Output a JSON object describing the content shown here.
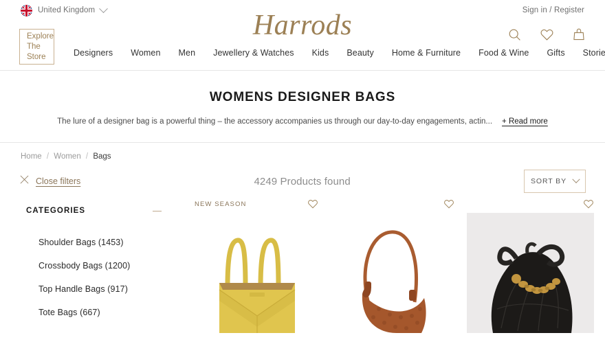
{
  "utility": {
    "locale_label": "United Kingdom",
    "locale_flag_icon": "uk-flag-icon",
    "locale_chevron_icon": "chevron-down-icon",
    "account_label": "Sign in / Register"
  },
  "brand": {
    "logo_text": "Harrods",
    "logo_color": "#9c8055"
  },
  "header_icons": [
    {
      "name": "search-icon",
      "label": "Search"
    },
    {
      "name": "heart-icon",
      "label": "Wishlist"
    },
    {
      "name": "shopping-bag-icon",
      "label": "Bag"
    }
  ],
  "nav": {
    "explore_line1": "Explore",
    "explore_line2": "The Store",
    "links": [
      {
        "label": "Designers"
      },
      {
        "label": "Women"
      },
      {
        "label": "Men"
      },
      {
        "label": "Jewellery & Watches"
      },
      {
        "label": "Kids"
      },
      {
        "label": "Beauty"
      },
      {
        "label": "Home & Furniture"
      },
      {
        "label": "Food & Wine"
      },
      {
        "label": "Gifts"
      },
      {
        "label": "Stories"
      }
    ]
  },
  "hero": {
    "title": "WOMENS DESIGNER BAGS",
    "description": "The lure of a designer bag is a powerful thing – the accessory accompanies us through our day-to-day engagements, actin...",
    "read_more_label": "+ Read more"
  },
  "breadcrumb": [
    {
      "label": "Home",
      "current": false
    },
    {
      "label": "Women",
      "current": false
    },
    {
      "label": "Bags",
      "current": true
    }
  ],
  "toolbar": {
    "close_filters_label": "Close filters",
    "close_filters_icon": "close-x-icon",
    "products_found": "4249 Products found",
    "sort_by_label": "SORT BY",
    "sort_chevron_icon": "chevron-down-icon"
  },
  "sidebar": {
    "facet_title": "CATEGORIES",
    "collapse_icon": "minus-icon",
    "items": [
      {
        "label": "Shoulder Bags (1453)"
      },
      {
        "label": "Crossbody Bags (1200)"
      },
      {
        "label": "Top Handle Bags (917)"
      },
      {
        "label": "Tote Bags (667)"
      }
    ]
  },
  "products": [
    {
      "badge": "NEW SEASON",
      "wishlist_icon": "heart-icon",
      "image_description": "yellow leather tote bag with two handles",
      "colors": {
        "body": "#e0c54e",
        "shade": "#c9ac39",
        "handle": "#d8bd46",
        "interior": "#b08a4a"
      },
      "background": "#ffffff"
    },
    {
      "badge": "",
      "wishlist_icon": "heart-icon",
      "image_description": "brown monogram crescent shoulder bag",
      "colors": {
        "body": "#a5572c",
        "shade": "#8e4622",
        "handle": "#a95c30",
        "interior": "#7d3d1c"
      },
      "background": "#ffffff"
    },
    {
      "badge": "",
      "wishlist_icon": "heart-icon",
      "image_description": "black crinkled leather drawstring bag with gold chain",
      "colors": {
        "body": "#1c1a18",
        "shade": "#3a3734",
        "handle": "#262422",
        "chain": "#c2953f"
      },
      "background": "#eceaea"
    }
  ]
}
